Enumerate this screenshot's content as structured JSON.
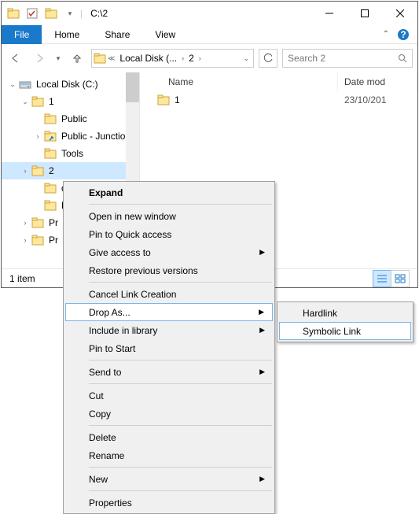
{
  "title": "C:\\2",
  "ribbon": {
    "file": "File",
    "home": "Home",
    "share": "Share",
    "view": "View"
  },
  "nav": {
    "breadcrumb": [
      "Local Disk (...",
      "2"
    ],
    "search_placeholder": "Search 2"
  },
  "tree": {
    "items": [
      {
        "label": "Local Disk (C:)",
        "depth": 0,
        "twisty": "v",
        "icon": "disk"
      },
      {
        "label": "1",
        "depth": 1,
        "twisty": "v",
        "icon": "folder"
      },
      {
        "label": "Public",
        "depth": 2,
        "twisty": "",
        "icon": "folder"
      },
      {
        "label": "Public - Junction",
        "depth": 2,
        "twisty": ">",
        "icon": "junction"
      },
      {
        "label": "Tools",
        "depth": 2,
        "twisty": "",
        "icon": "folder"
      },
      {
        "label": "2",
        "depth": 1,
        "twisty": ">",
        "icon": "folder",
        "selected": true
      },
      {
        "label": "da",
        "depth": 2,
        "twisty": "",
        "icon": "folder"
      },
      {
        "label": "Pe",
        "depth": 2,
        "twisty": "",
        "icon": "folder"
      },
      {
        "label": "Pr",
        "depth": 1,
        "twisty": ">",
        "icon": "folder"
      },
      {
        "label": "Pr",
        "depth": 1,
        "twisty": ">",
        "icon": "folder"
      }
    ]
  },
  "cols": {
    "name": "Name",
    "date": "Date mod"
  },
  "rows": [
    {
      "name": "1",
      "date": "23/10/201"
    }
  ],
  "status": {
    "count": "1 item"
  },
  "menu": {
    "expand": "Expand",
    "open_new": "Open in new window",
    "pin_qa": "Pin to Quick access",
    "give_access": "Give access to",
    "restore": "Restore previous versions",
    "cancel_link": "Cancel Link Creation",
    "drop_as": "Drop As...",
    "include_lib": "Include in library",
    "pin_start": "Pin to Start",
    "send_to": "Send to",
    "cut": "Cut",
    "copy": "Copy",
    "delete": "Delete",
    "rename": "Rename",
    "new": "New",
    "properties": "Properties"
  },
  "submenu": {
    "hardlink": "Hardlink",
    "symlink": "Symbolic Link"
  }
}
